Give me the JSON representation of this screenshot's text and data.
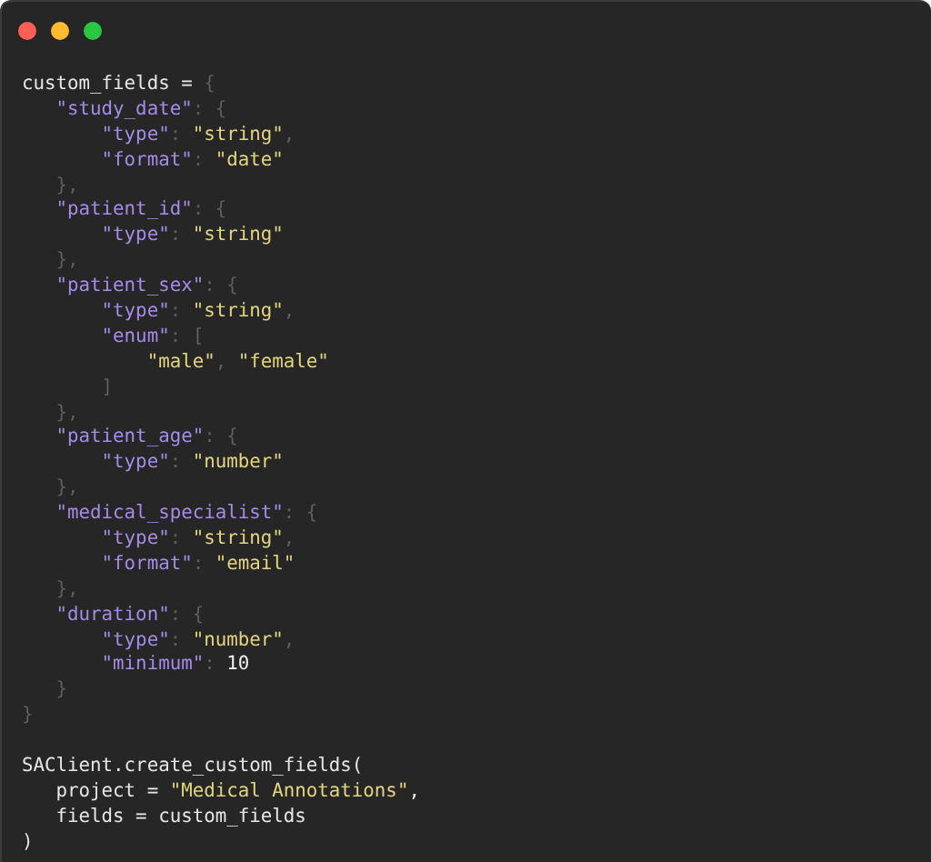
{
  "window": {
    "controls": [
      {
        "color": "#fe5f57"
      },
      {
        "color": "#febc2e"
      },
      {
        "color": "#28c840"
      }
    ]
  },
  "code_blocks": [
    {
      "lines": [
        [
          {
            "kind": "plain",
            "text": "custom_fields = "
          },
          {
            "kind": "punct",
            "text": "{"
          }
        ],
        [
          {
            "kind": "key",
            "text": "   \"study_date\""
          },
          {
            "kind": "punct",
            "text": ": {"
          }
        ],
        [
          {
            "kind": "key",
            "text": "       \"type\""
          },
          {
            "kind": "punct",
            "text": ": "
          },
          {
            "kind": "str",
            "text": "\"string\""
          },
          {
            "kind": "punct",
            "text": ","
          }
        ],
        [
          {
            "kind": "key",
            "text": "       \"format\""
          },
          {
            "kind": "punct",
            "text": ": "
          },
          {
            "kind": "str",
            "text": "\"date\""
          }
        ],
        [
          {
            "kind": "punct",
            "text": "   },"
          }
        ],
        [
          {
            "kind": "key",
            "text": "   \"patient_id\""
          },
          {
            "kind": "punct",
            "text": ": {"
          }
        ],
        [
          {
            "kind": "key",
            "text": "       \"type\""
          },
          {
            "kind": "punct",
            "text": ": "
          },
          {
            "kind": "str",
            "text": "\"string\""
          }
        ],
        [
          {
            "kind": "punct",
            "text": "   },"
          }
        ],
        [
          {
            "kind": "key",
            "text": "   \"patient_sex\""
          },
          {
            "kind": "punct",
            "text": ": {"
          }
        ],
        [
          {
            "kind": "key",
            "text": "       \"type\""
          },
          {
            "kind": "punct",
            "text": ": "
          },
          {
            "kind": "str",
            "text": "\"string\""
          },
          {
            "kind": "punct",
            "text": ","
          }
        ],
        [
          {
            "kind": "key",
            "text": "       \"enum\""
          },
          {
            "kind": "punct",
            "text": ": ["
          }
        ],
        [
          {
            "kind": "str",
            "text": "           \"male\""
          },
          {
            "kind": "punct",
            "text": ", "
          },
          {
            "kind": "str",
            "text": "\"female\""
          }
        ],
        [
          {
            "kind": "punct",
            "text": "       ]"
          }
        ],
        [
          {
            "kind": "punct",
            "text": "   },"
          }
        ],
        [
          {
            "kind": "key",
            "text": "   \"patient_age\""
          },
          {
            "kind": "punct",
            "text": ": {"
          }
        ],
        [
          {
            "kind": "key",
            "text": "       \"type\""
          },
          {
            "kind": "punct",
            "text": ": "
          },
          {
            "kind": "str",
            "text": "\"number\""
          }
        ],
        [
          {
            "kind": "punct",
            "text": "   },"
          }
        ],
        [
          {
            "kind": "key",
            "text": "   \"medical_specialist\""
          },
          {
            "kind": "punct",
            "text": ": {"
          }
        ],
        [
          {
            "kind": "key",
            "text": "       \"type\""
          },
          {
            "kind": "punct",
            "text": ": "
          },
          {
            "kind": "str",
            "text": "\"string\""
          },
          {
            "kind": "punct",
            "text": ","
          }
        ],
        [
          {
            "kind": "key",
            "text": "       \"format\""
          },
          {
            "kind": "punct",
            "text": ": "
          },
          {
            "kind": "str",
            "text": "\"email\""
          }
        ],
        [
          {
            "kind": "punct",
            "text": "   },"
          }
        ],
        [
          {
            "kind": "key",
            "text": "   \"duration\""
          },
          {
            "kind": "punct",
            "text": ": {"
          }
        ],
        [
          {
            "kind": "key",
            "text": "       \"type\""
          },
          {
            "kind": "punct",
            "text": ": "
          },
          {
            "kind": "str",
            "text": "\"number\""
          },
          {
            "kind": "punct",
            "text": ","
          }
        ],
        [
          {
            "kind": "key",
            "text": "       \"minimum\""
          },
          {
            "kind": "punct",
            "text": ": "
          },
          {
            "kind": "num",
            "text": "10"
          }
        ],
        [
          {
            "kind": "punct",
            "text": "   }"
          }
        ],
        [
          {
            "kind": "punct",
            "text": "}"
          }
        ]
      ]
    },
    {
      "lines": [
        [
          {
            "kind": "plain",
            "text": "SAClient.create_custom_fields("
          }
        ],
        [
          {
            "kind": "plain",
            "text": "   project = "
          },
          {
            "kind": "str",
            "text": "\"Medical Annotations\""
          },
          {
            "kind": "plain",
            "text": ","
          }
        ],
        [
          {
            "kind": "plain",
            "text": "   fields = custom_fields"
          }
        ],
        [
          {
            "kind": "plain",
            "text": ")"
          }
        ]
      ]
    }
  ]
}
